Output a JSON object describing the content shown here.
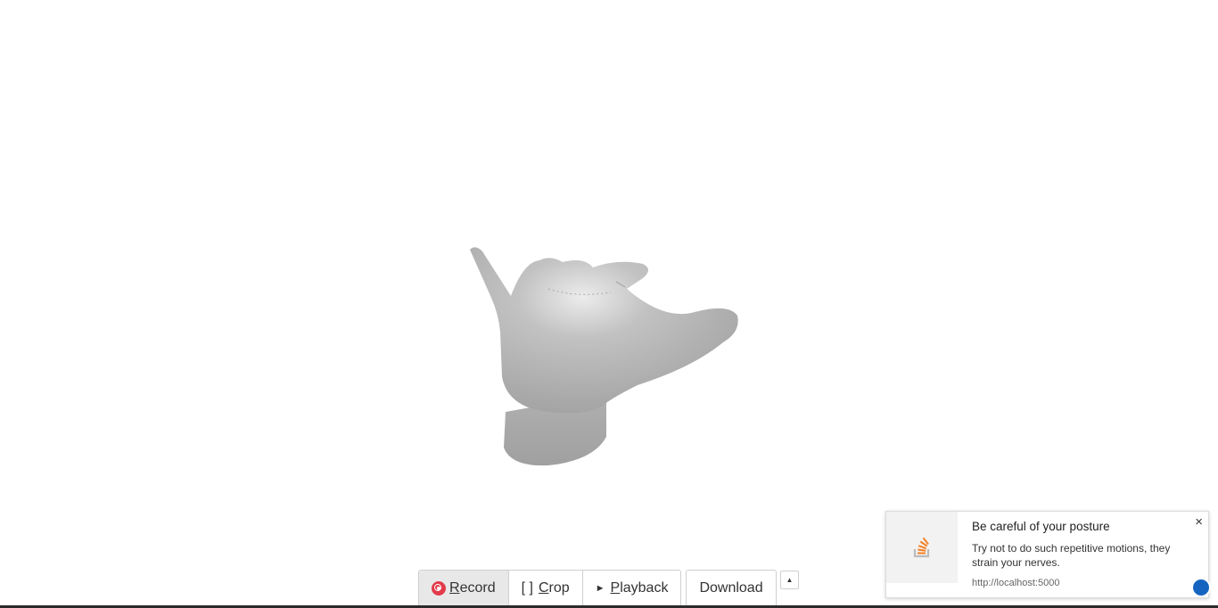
{
  "toolbar": {
    "record_label": "Record",
    "record_mnemonic": "R",
    "record_rest": "ecord",
    "crop_glyph": "[ ]",
    "crop_mnemonic": "C",
    "crop_rest": "rop",
    "playback_glyph": "►",
    "playback_mnemonic": "P",
    "playback_rest": "layback",
    "download_label": "Download",
    "expand_glyph": "▲"
  },
  "notification": {
    "title": "Be careful of your posture",
    "message": "Try not to do such repetitive motions, they strain your nerves.",
    "source": "http://localhost:5000",
    "close_glyph": "×",
    "icon": "stackoverflow-icon"
  },
  "colors": {
    "record_red": "#e33b4a",
    "model_gray": "#a8a8a8",
    "brand_orange": "#f48024",
    "badge_blue": "#1565c0"
  }
}
